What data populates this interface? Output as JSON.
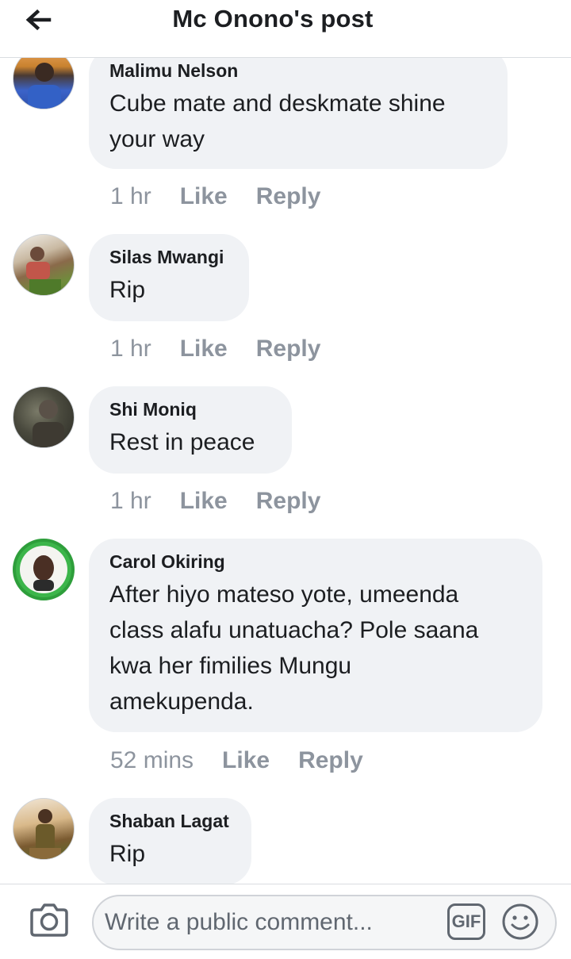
{
  "header": {
    "title": "Mc Onono's post",
    "back_icon": "back-arrow-icon"
  },
  "comments": [
    {
      "author": "Malimu Nelson",
      "lines": [
        "Cube mate and deskmate shine",
        "your way"
      ],
      "time": "1 hr",
      "like": "Like",
      "reply": "Reply"
    },
    {
      "author": "Silas Mwangi",
      "lines": [
        "Rip"
      ],
      "time": "1 hr",
      "like": "Like",
      "reply": "Reply"
    },
    {
      "author": "Shi Moniq",
      "lines": [
        "Rest in peace"
      ],
      "time": "1 hr",
      "like": "Like",
      "reply": "Reply"
    },
    {
      "author": "Carol Okiring",
      "lines": [
        "After hiyo mateso yote, umeenda",
        "class alafu unatuacha? Pole saana",
        "kwa her fimilies Mungu",
        "amekupenda."
      ],
      "time": "52 mins",
      "like": "Like",
      "reply": "Reply"
    },
    {
      "author": "Shaban Lagat",
      "lines": [
        "Rip"
      ]
    }
  ],
  "composer": {
    "placeholder": "Write a public comment...",
    "gif_label": "GIF",
    "camera_icon": "camera-icon",
    "emoji_icon": "smiley-icon"
  },
  "colors": {
    "bubble": "#f0f2f5",
    "meta_text": "#8d949e",
    "primary_text": "#1c1e21"
  }
}
